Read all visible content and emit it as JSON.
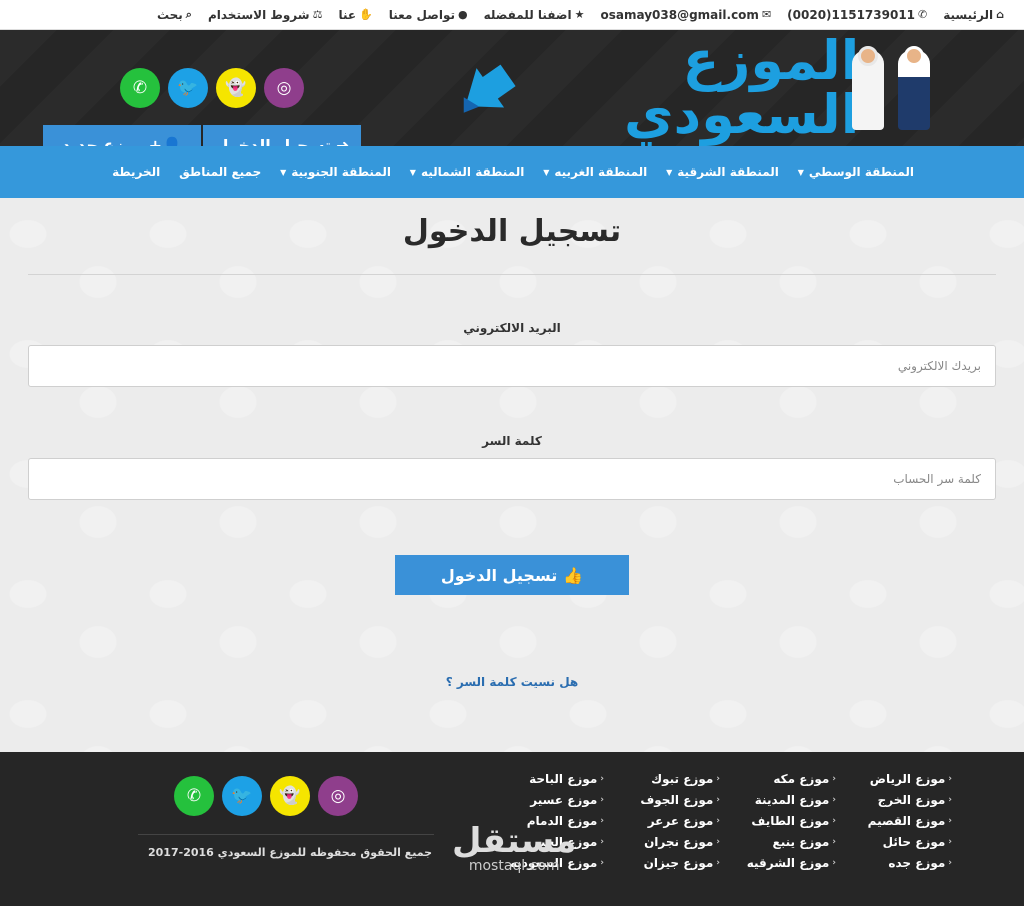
{
  "topbar": {
    "items": [
      {
        "label": "الرئيسية",
        "icon": "home-icon",
        "glyph": "⌂"
      },
      {
        "label": "(0020)1151739011",
        "icon": "phone-icon",
        "glyph": "✆"
      },
      {
        "label": "osamay038@gmail.com",
        "icon": "envelope-icon",
        "glyph": "✉"
      },
      {
        "label": "اضفنا للمفضله",
        "icon": "star-icon",
        "glyph": "★"
      },
      {
        "label": "تواصل معنا",
        "icon": "chat-icon",
        "glyph": "💬"
      },
      {
        "label": "عنا",
        "icon": "handshake-icon",
        "glyph": "🤝"
      },
      {
        "label": "شروط الاستخدام",
        "icon": "scale-icon",
        "glyph": "⚖"
      },
      {
        "label": "بحث",
        "icon": "search-icon",
        "glyph": "⌕"
      }
    ]
  },
  "header": {
    "logo_text": "الموزع السعودي",
    "buttons": {
      "login": "تسجيل الدخول",
      "new_distributor": "موزع جديد"
    },
    "social": [
      "whatsapp-icon",
      "twitter-icon",
      "snapchat-icon",
      "instagram-icon"
    ],
    "colors": {
      "whatsapp": "#25c13d",
      "twitter": "#1da1e6",
      "snapchat": "#f5e500",
      "instagram": "#8f3e8c",
      "accent": "#3598db"
    }
  },
  "nav": {
    "items": [
      {
        "label": "المنطقة الوسطي",
        "dropdown": true
      },
      {
        "label": "المنطقة الشرقية",
        "dropdown": true
      },
      {
        "label": "المنطقة الغربيه",
        "dropdown": true
      },
      {
        "label": "المنطقة الشماليه",
        "dropdown": true
      },
      {
        "label": "المنطقة الجنوبية",
        "dropdown": true
      },
      {
        "label": "جميع المناطق",
        "dropdown": false
      },
      {
        "label": "الخريطة",
        "dropdown": false
      }
    ]
  },
  "login_form": {
    "title": "تسجيل الدخول",
    "email_label": "البريد الالكتروني",
    "email_placeholder": "بريدك الالكتروني",
    "password_label": "كلمة السر",
    "password_placeholder": "كلمة سر الحساب",
    "submit_label": "تسجيل الدخول",
    "forgot_label": "هل نسيت كلمة السر ؟"
  },
  "footer": {
    "columns": [
      [
        "موزع الرياض",
        "موزع الخرج",
        "موزع القصيم",
        "موزع حائل",
        "موزع جده"
      ],
      [
        "موزع مكه",
        "موزع المدينة",
        "موزع الطايف",
        "موزع ينبع",
        "موزع الشرقيه"
      ],
      [
        "موزع تبوك",
        "موزع الجوف",
        "موزع عرعر",
        "موزع نجران",
        "موزع جيزان"
      ],
      [
        "موزع الباحة",
        "موزع عسير",
        "موزع الدمام",
        "موزع الخبر",
        "موزع السعوديه"
      ]
    ],
    "copyright": "جميع الحقوق محفوظه للموزع السعودي 2016-2017",
    "watermark_ar": "مستقل",
    "watermark_en": "mostaql.com"
  }
}
